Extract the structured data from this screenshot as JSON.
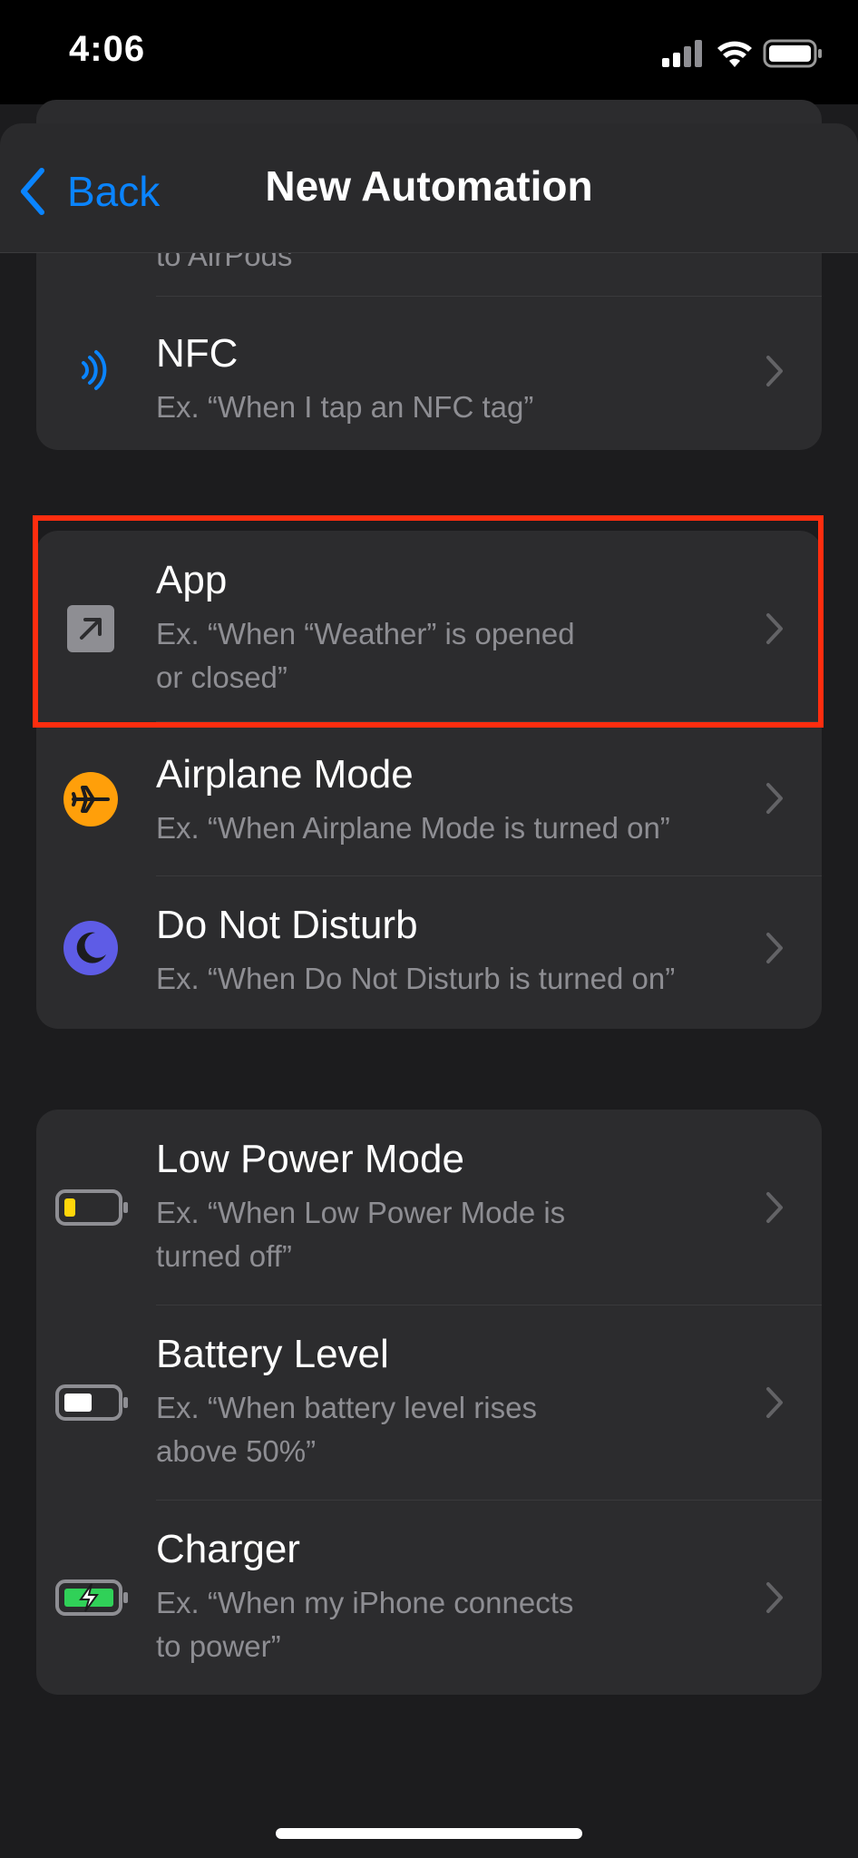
{
  "status_bar": {
    "time": "4:06"
  },
  "nav": {
    "back_label": "Back",
    "title": "New Automation"
  },
  "group1": {
    "partial_text": "to AirPods",
    "nfc": {
      "title": "NFC",
      "subtitle": "Ex. “When I tap an NFC tag”",
      "icon": "nfc-icon"
    }
  },
  "group2": {
    "items": [
      {
        "title": "App",
        "subtitle_line1": "Ex. “When “Weather” is opened",
        "subtitle_line2": "or closed”",
        "icon": "app-arrow-icon"
      },
      {
        "title": "Airplane Mode",
        "subtitle_line1": "Ex. “When Airplane Mode is turned on”",
        "icon": "airplane-icon",
        "color": "#ff9f0a"
      },
      {
        "title": "Do Not Disturb",
        "subtitle_line1": "Ex. “When Do Not Disturb is turned on”",
        "icon": "moon-icon",
        "color": "#5e5ce6"
      }
    ]
  },
  "group3": {
    "items": [
      {
        "title": "Low Power Mode",
        "subtitle_line1": "Ex. “When Low Power Mode is",
        "subtitle_line2": "turned off”",
        "icon": "low-battery-icon",
        "color": "#ffd60a"
      },
      {
        "title": "Battery Level",
        "subtitle_line1": "Ex. “When battery level rises",
        "subtitle_line2": "above 50%”",
        "icon": "battery-icon"
      },
      {
        "title": "Charger",
        "subtitle_line1": "Ex. “When my iPhone connects",
        "subtitle_line2": "to power”",
        "icon": "charging-battery-icon",
        "color": "#30d158"
      }
    ]
  },
  "colors": {
    "accent": "#0a84ff",
    "highlight_border": "#ff2d0f",
    "background": "#1c1c1e",
    "cell": "#2c2c2e",
    "secondary_text": "#8e8e93"
  }
}
